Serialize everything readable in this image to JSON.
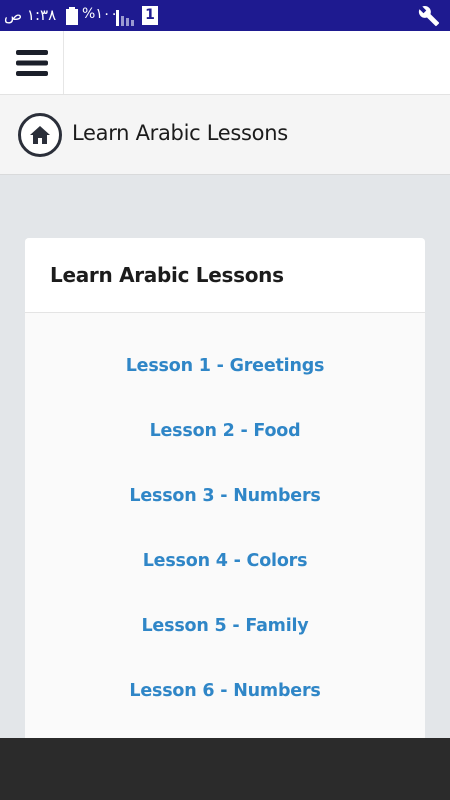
{
  "status_bar": {
    "time": "١:٣٨ ص",
    "battery_percent": "%١٠٠",
    "sim_slot": "1",
    "icons": [
      "battery-icon",
      "signal-icon",
      "sim-icon",
      "wrench-icon"
    ]
  },
  "nav": {
    "menu_icon": "hamburger-menu-icon"
  },
  "header": {
    "home_icon": "home-icon",
    "title": "Learn Arabic Lessons"
  },
  "card": {
    "title": "Learn Arabic Lessons",
    "lessons": [
      {
        "label": "Lesson 1 - Greetings"
      },
      {
        "label": "Lesson 2 - Food"
      },
      {
        "label": "Lesson 3 - Numbers"
      },
      {
        "label": "Lesson 4 - Colors"
      },
      {
        "label": "Lesson 5 - Family"
      },
      {
        "label": "Lesson 6 - Numbers"
      }
    ]
  },
  "colors": {
    "status_bar": "#1e1a90",
    "link": "#2f86c7",
    "background": "#e3e6e9",
    "bottom_bar": "#2b2b2b"
  }
}
